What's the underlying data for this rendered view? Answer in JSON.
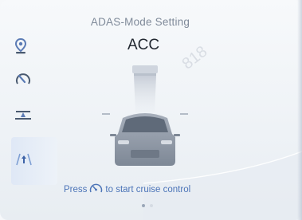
{
  "screen": {
    "title": "ADAS-Mode Setting",
    "mode_value": "ACC",
    "hint_before": "Press",
    "hint_after": "to start cruise control",
    "watermark_text": "818"
  },
  "sidebar": {
    "items": [
      {
        "icon": "location-pin-icon",
        "active": false
      },
      {
        "icon": "speed-limit-icon",
        "active": false
      },
      {
        "icon": "lane-keep-icon",
        "active": false
      },
      {
        "icon": "adaptive-cruise-icon",
        "active": true
      }
    ]
  },
  "pagination": {
    "total": 2,
    "current": 1
  },
  "colors": {
    "accent": "#4c74b8",
    "title": "#7f8a99",
    "mode": "#222831",
    "icon_blue": "#5b7bb5",
    "icon_dark": "#4a5a70"
  }
}
